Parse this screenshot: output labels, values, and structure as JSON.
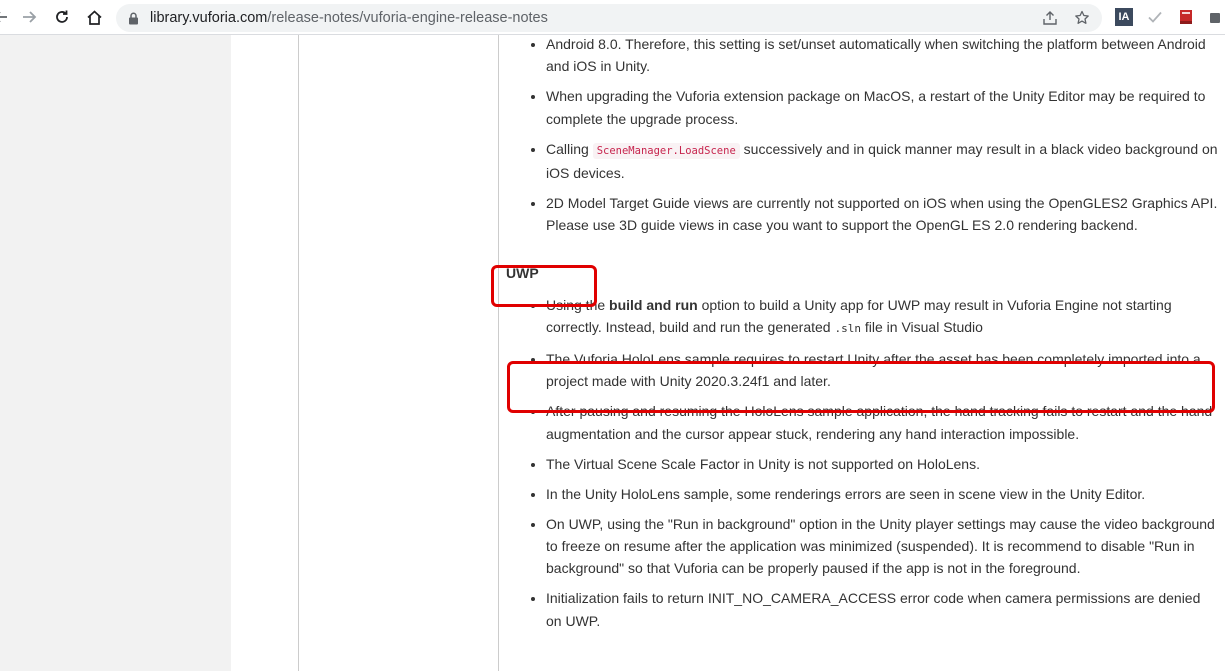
{
  "browser": {
    "url_host": "library.vuforia.com",
    "url_path": "/release-notes/vuforia-engine-release-notes",
    "extension_ia_label": "IA"
  },
  "colors": {
    "highlight": "#e00000",
    "inline_code": "#c7254e",
    "gutter": "#f2f2f2"
  },
  "content": {
    "top_items": [
      {
        "text": "Android 8.0. Therefore, this setting is set/unset automatically when switching the platform between Android and iOS in Unity."
      },
      {
        "text": "When upgrading the Vuforia extension package on MacOS, a restart of the Unity Editor may be required to complete the upgrade process."
      },
      {
        "before": "Calling ",
        "code": "SceneManager.LoadScene",
        "after": " successively and in quick manner may result in a black video background on iOS devices."
      },
      {
        "text": "2D Model Target Guide views are currently not supported on iOS when using the OpenGLES2 Graphics API. Please use 3D guide views in case you want to support the OpenGL ES 2.0 rendering backend."
      }
    ],
    "section_heading": "UWP",
    "uwp_items": [
      {
        "before": "Using the ",
        "bold": "build and run",
        "middle": " option to build a Unity app for UWP may result in Vuforia Engine not starting correctly. Instead, build and run the generated ",
        "code": ".sln",
        "after": " file in Visual Studio"
      },
      {
        "text": "The Vuforia HoloLens sample requires to restart Unity after the asset has been completely imported into a project made with Unity 2020.3.24f1 and later."
      },
      {
        "text": "After pausing and resuming the HoloLens sample application, the hand tracking fails to restart and the hand augmentation and the cursor appear stuck, rendering any hand interaction impossible."
      },
      {
        "text": "The Virtual Scene Scale Factor in Unity is not supported on HoloLens."
      },
      {
        "text": "In the Unity HoloLens sample, some renderings errors are seen in scene view in the Unity Editor."
      },
      {
        "text": "On UWP, using the \"Run in background\" option in the Unity player settings may cause the video background to freeze on resume after the application was minimized (suspended). It is recommend to disable \"Run in background\" so that Vuforia can be properly paused if the app is not in the foreground."
      },
      {
        "text": "Initialization fails to return INIT_NO_CAMERA_ACCESS error code when camera permissions are denied on UWP."
      }
    ]
  }
}
